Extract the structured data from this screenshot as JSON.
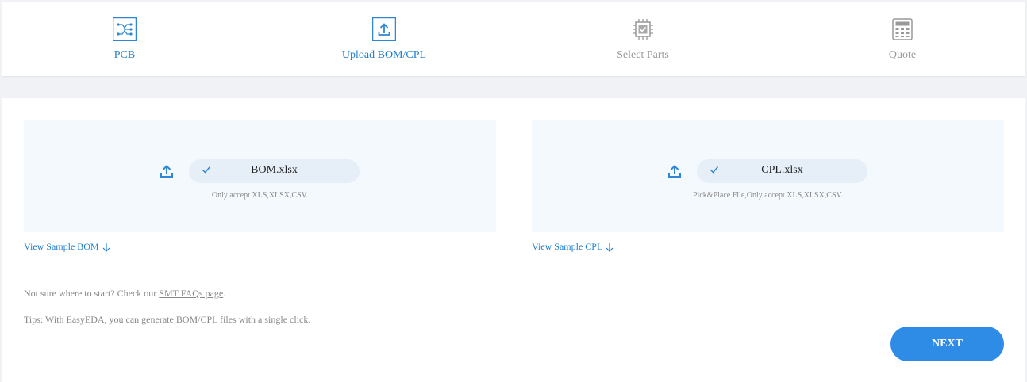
{
  "steps": [
    {
      "label": "PCB",
      "icon": "pcb-circuit-icon",
      "state": "done"
    },
    {
      "label": "Upload BOM/CPL",
      "icon": "upload-icon",
      "state": "active"
    },
    {
      "label": "Select Parts",
      "icon": "chip-check-icon",
      "state": "pending"
    },
    {
      "label": "Quote",
      "icon": "calculator-icon",
      "state": "pending"
    }
  ],
  "bom": {
    "filename": "BOM.xlsx",
    "hint": "Only accept XLS,XLSX,CSV.",
    "sample_link": "View Sample BOM"
  },
  "cpl": {
    "filename": "CPL.xlsx",
    "hint": "Pick&Place File,Only accept XLS,XLSX,CSV.",
    "sample_link": "View Sample CPL"
  },
  "notes": {
    "start_prefix": "Not sure where to start? Check our ",
    "faq_link": "SMT FAQs page",
    "start_suffix": ".",
    "tips": "Tips: With EasyEDA, you can generate BOM/CPL files with a single click."
  },
  "next_label": "NEXT",
  "colors": {
    "accent": "#1e7fd0",
    "button": "#2e8be6",
    "upload_bg": "#f4f9fe",
    "pill_bg": "#e6eff8",
    "page_bg": "#f0f2f5"
  }
}
